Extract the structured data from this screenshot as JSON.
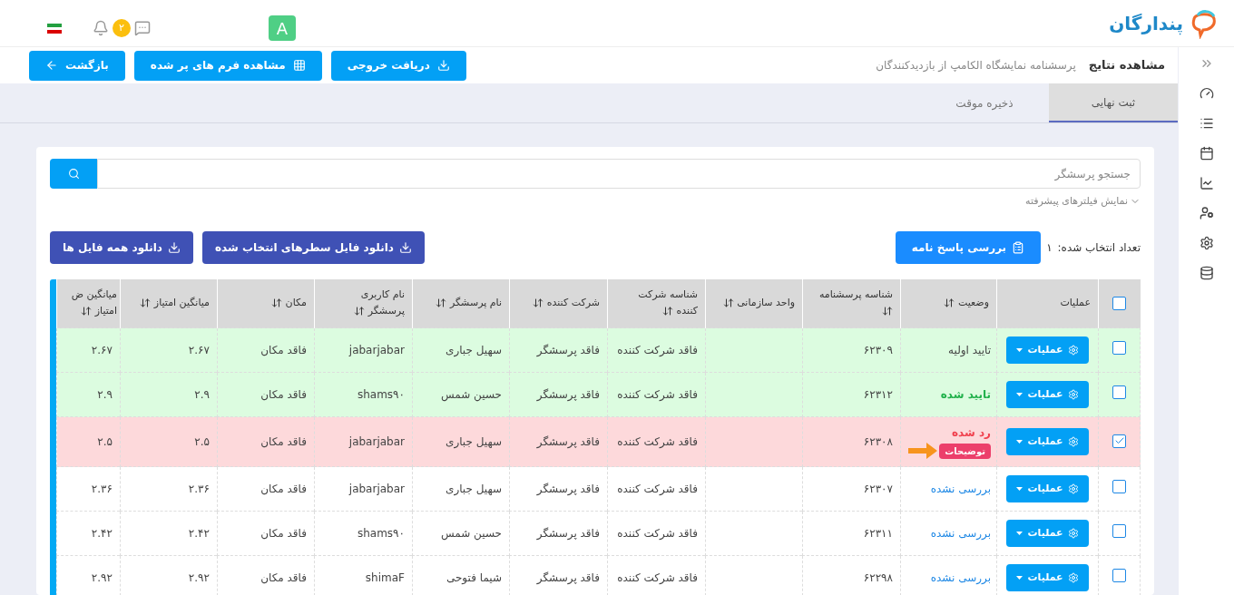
{
  "topbar": {
    "avatar": "A",
    "notification_count": "۲",
    "brand": "پندارگان"
  },
  "header": {
    "title": "مشاهده نتایج",
    "subtitle": "پرسشنامه نمایشگاه الکامپ از بازدیدکنندگان",
    "buttons": [
      {
        "label": "دریافت خروجی",
        "kind": "download"
      },
      {
        "label": "مشاهده فرم های پر شده",
        "kind": "grid"
      },
      {
        "label": "بازگشت",
        "kind": "back"
      }
    ]
  },
  "tabs": [
    {
      "label": "ثبت نهایی",
      "selected": true
    },
    {
      "label": "ذخیره موقت",
      "selected": false
    }
  ],
  "search": {
    "placeholder": "جستجو پرسشگر"
  },
  "advanced_filters": "نمایش فیلترهای پیشرفته",
  "selection": {
    "label": "تعداد انتخاب شده:",
    "count": "۱"
  },
  "review_button": "بررسی پاسخ نامه",
  "download_buttons": [
    "دانلود فایل سطرهای انتخاب شده",
    "دانلود همه فایل ها"
  ],
  "table": {
    "columns": [
      {
        "kind": "select",
        "checked": false
      },
      {
        "kind": "plain",
        "label": "عملیات"
      },
      {
        "kind": "sortable",
        "label": "وضعیت"
      },
      {
        "kind": "sortable",
        "label": "شناسه پرسشنامه"
      },
      {
        "kind": "sortable",
        "label": "واحد سازمانی"
      },
      {
        "kind": "sortable",
        "label": "شناسه شرکت کننده"
      },
      {
        "kind": "sortable",
        "label": "شرکت کننده"
      },
      {
        "kind": "sortable",
        "label": "نام پرسشگر"
      },
      {
        "kind": "sortable",
        "label": "نام کاربری پرسشگر"
      },
      {
        "kind": "sortable",
        "label": "مکان"
      },
      {
        "kind": "sortable",
        "label": "میانگین امتیاز"
      },
      {
        "kind": "sortable",
        "label": "میانگین ض امتیاز"
      }
    ],
    "rows": [
      {
        "cells": [
          {
            "kind": "select",
            "checked": false
          },
          {
            "kind": "action",
            "text": "عملیات"
          },
          {
            "kind": "initial",
            "text": "تایید اولیه",
            "arrow": false
          },
          {
            "kind": "text",
            "text": "۶۲۳۰۹"
          },
          {
            "kind": "text",
            "text": ""
          },
          {
            "kind": "text",
            "text": "فاقد شرکت کننده"
          },
          {
            "kind": "text",
            "text": "فاقد پرسشگر"
          },
          {
            "kind": "text",
            "text": "سهیل جباری"
          },
          {
            "kind": "text",
            "text": "jabarjabar"
          },
          {
            "kind": "text",
            "text": "فاقد مکان"
          },
          {
            "kind": "text",
            "text": "۲.۶۷"
          },
          {
            "kind": "text",
            "text": "۲.۶۷"
          }
        ]
      },
      {
        "cells": [
          {
            "kind": "select",
            "checked": false
          },
          {
            "kind": "action",
            "text": "عملیات"
          },
          {
            "kind": "approved",
            "text": "تایید شده",
            "arrow": false
          },
          {
            "kind": "text",
            "text": "۶۲۳۱۲"
          },
          {
            "kind": "text",
            "text": ""
          },
          {
            "kind": "text",
            "text": "فاقد شرکت کننده"
          },
          {
            "kind": "text",
            "text": "فاقد پرسشگر"
          },
          {
            "kind": "text",
            "text": "حسین شمس"
          },
          {
            "kind": "text",
            "text": "shams۹۰"
          },
          {
            "kind": "text",
            "text": "فاقد مکان"
          },
          {
            "kind": "text",
            "text": "۲.۹"
          },
          {
            "kind": "text",
            "text": "۲.۹"
          }
        ]
      },
      {
        "cells": [
          {
            "kind": "select",
            "checked": true
          },
          {
            "kind": "action",
            "text": "عملیات"
          },
          {
            "kind": "rejected",
            "text": "رد شده",
            "note": "توضیحات",
            "arrow": true
          },
          {
            "kind": "text",
            "text": "۶۲۳۰۸"
          },
          {
            "kind": "text",
            "text": ""
          },
          {
            "kind": "text",
            "text": "فاقد شرکت کننده"
          },
          {
            "kind": "text",
            "text": "فاقد پرسشگر"
          },
          {
            "kind": "text",
            "text": "سهیل جباری"
          },
          {
            "kind": "text",
            "text": "jabarjabar"
          },
          {
            "kind": "text",
            "text": "فاقد مکان"
          },
          {
            "kind": "text",
            "text": "۲.۵"
          },
          {
            "kind": "text",
            "text": "۲.۵"
          }
        ]
      },
      {
        "cells": [
          {
            "kind": "select",
            "checked": false
          },
          {
            "kind": "action",
            "text": "عملیات"
          },
          {
            "kind": "unreviewed",
            "text": "بررسی نشده",
            "arrow": false
          },
          {
            "kind": "text",
            "text": "۶۲۳۰۷"
          },
          {
            "kind": "text",
            "text": ""
          },
          {
            "kind": "text",
            "text": "فاقد شرکت کننده"
          },
          {
            "kind": "text",
            "text": "فاقد پرسشگر"
          },
          {
            "kind": "text",
            "text": "سهیل جباری"
          },
          {
            "kind": "text",
            "text": "jabarjabar"
          },
          {
            "kind": "text",
            "text": "فاقد مکان"
          },
          {
            "kind": "text",
            "text": "۲.۳۶"
          },
          {
            "kind": "text",
            "text": "۲.۳۶"
          }
        ]
      },
      {
        "cells": [
          {
            "kind": "select",
            "checked": false
          },
          {
            "kind": "action",
            "text": "عملیات"
          },
          {
            "kind": "unreviewed",
            "text": "بررسی نشده",
            "arrow": false
          },
          {
            "kind": "text",
            "text": "۶۲۳۱۱"
          },
          {
            "kind": "text",
            "text": ""
          },
          {
            "kind": "text",
            "text": "فاقد شرکت کننده"
          },
          {
            "kind": "text",
            "text": "فاقد پرسشگر"
          },
          {
            "kind": "text",
            "text": "حسین شمس"
          },
          {
            "kind": "text",
            "text": "shams۹۰"
          },
          {
            "kind": "text",
            "text": "فاقد مکان"
          },
          {
            "kind": "text",
            "text": "۲.۴۲"
          },
          {
            "kind": "text",
            "text": "۲.۴۲"
          }
        ]
      },
      {
        "cells": [
          {
            "kind": "select",
            "checked": false
          },
          {
            "kind": "action",
            "text": "عملیات"
          },
          {
            "kind": "unreviewed",
            "text": "بررسی نشده",
            "arrow": false
          },
          {
            "kind": "text",
            "text": "۶۲۲۹۸"
          },
          {
            "kind": "text",
            "text": ""
          },
          {
            "kind": "text",
            "text": "فاقد شرکت کننده"
          },
          {
            "kind": "text",
            "text": "فاقد پرسشگر"
          },
          {
            "kind": "text",
            "text": "شیما فتوحی"
          },
          {
            "kind": "text",
            "text": "shimaF"
          },
          {
            "kind": "text",
            "text": "فاقد مکان"
          },
          {
            "kind": "text",
            "text": "۲.۹۲"
          },
          {
            "kind": "text",
            "text": "۲.۹۲"
          }
        ]
      }
    ]
  }
}
